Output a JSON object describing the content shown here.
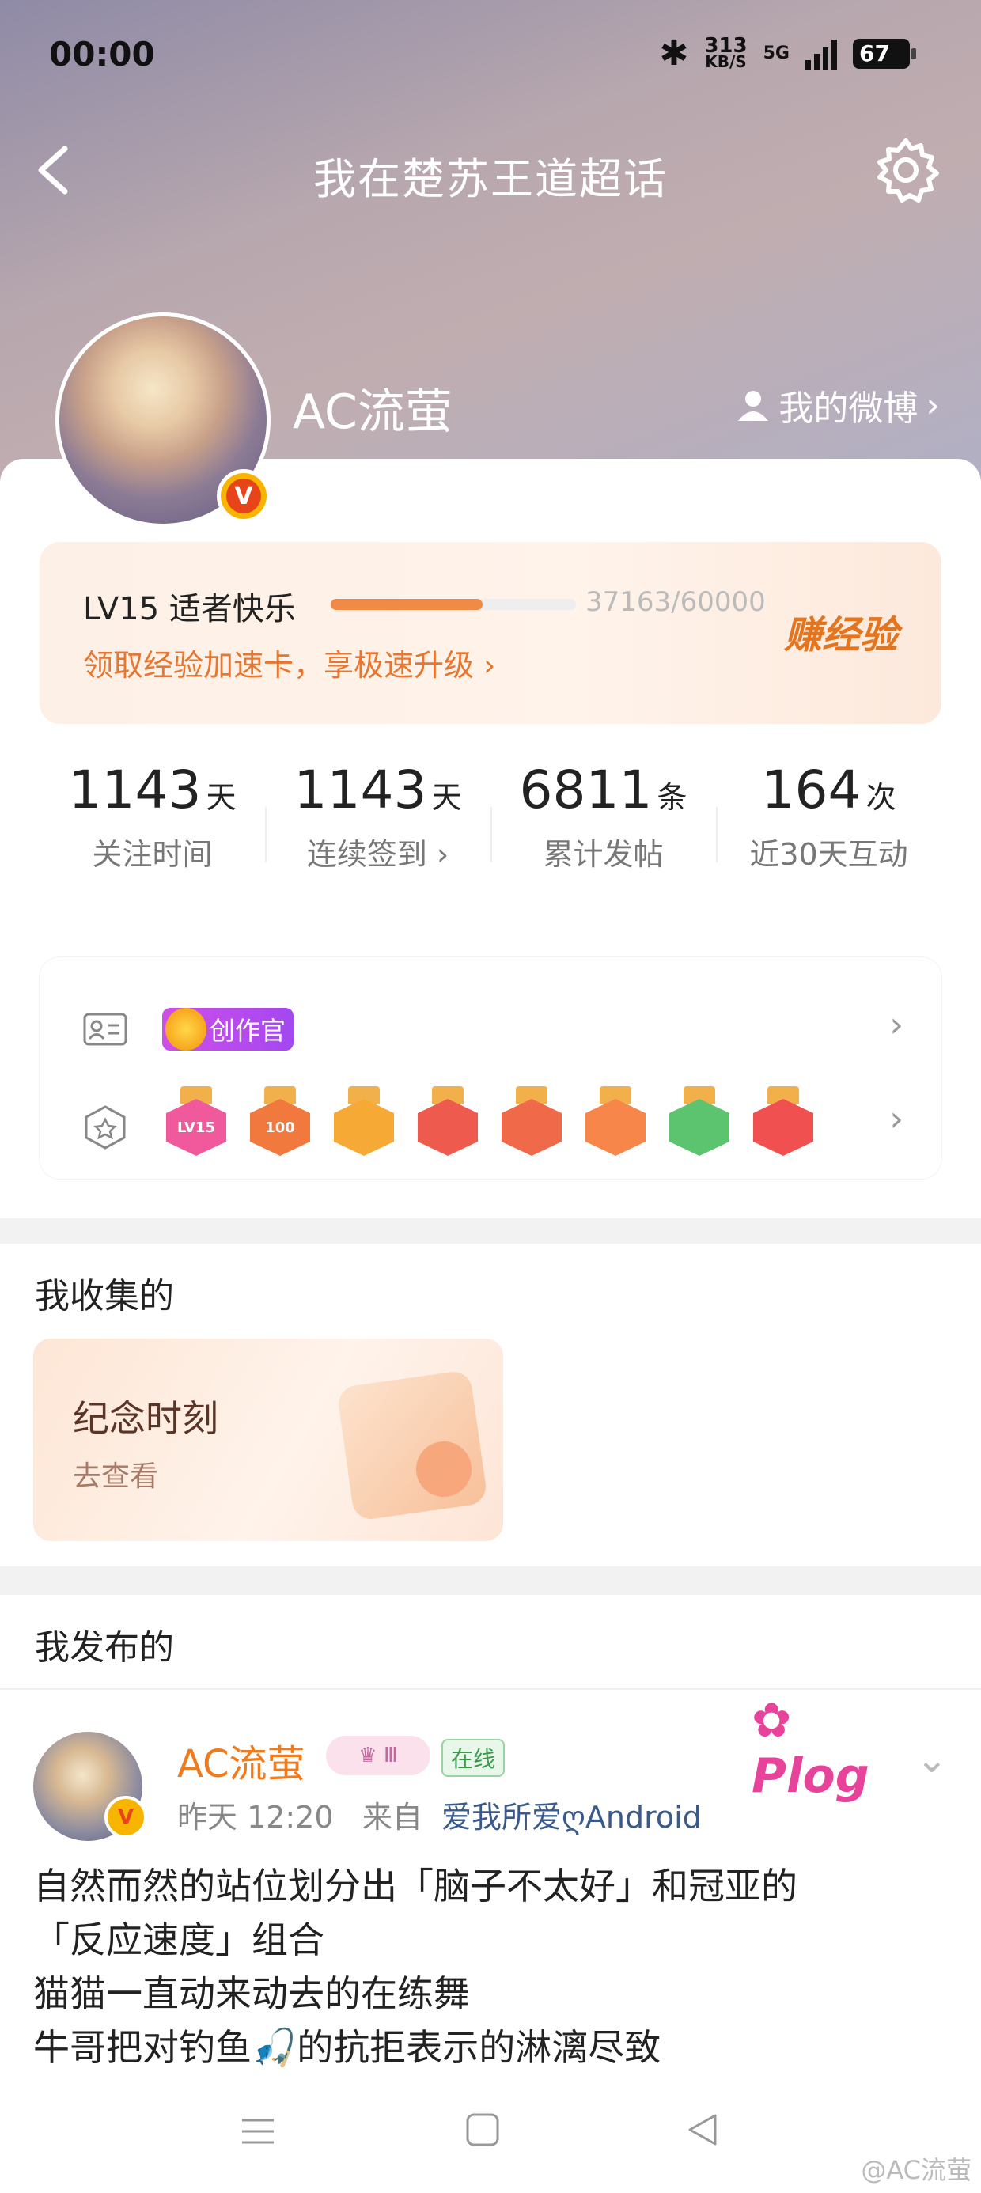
{
  "status_bar": {
    "time": "00:00",
    "net_speed": "313",
    "net_speed_unit": "KB/S",
    "network": "5G",
    "battery": "67"
  },
  "nav": {
    "title": "我在楚苏王道超话"
  },
  "profile": {
    "username": "AC流萤",
    "my_weibo": "我的微博"
  },
  "level": {
    "label": "LV15 适者快乐",
    "progress_text": "37163/60000",
    "progress_fraction": 0.619,
    "link": "领取经验加速卡，享极速升级",
    "earn": "赚经验"
  },
  "stats": [
    {
      "num": "1143",
      "unit": "天",
      "label": "关注时间"
    },
    {
      "num": "1143",
      "unit": "天",
      "label": "连续签到"
    },
    {
      "num": "6811",
      "unit": "条",
      "label": "累计发帖"
    },
    {
      "num": "164",
      "unit": "次",
      "label": "近30天互动"
    }
  ],
  "badges": {
    "creator_label": "创作官",
    "medals": [
      {
        "text": "LV15",
        "color": "#f05a9c"
      },
      {
        "text": "100",
        "color": "#f1793d"
      },
      {
        "text": "",
        "color": "#f7a935"
      },
      {
        "text": "",
        "color": "#ef5a4e"
      },
      {
        "text": "",
        "color": "#f06a4a"
      },
      {
        "text": "",
        "color": "#f6864a"
      },
      {
        "text": "",
        "color": "#5cc46f"
      },
      {
        "text": "",
        "color": "#f0504f"
      }
    ]
  },
  "collected": {
    "title": "我收集的",
    "card_title": "纪念时刻",
    "card_sub": "去查看"
  },
  "published": {
    "title": "我发布的"
  },
  "post": {
    "author": "AC流萤",
    "online": "在线",
    "time": "昨天 12:20",
    "from": "来自",
    "source": "爱我所爱ღAndroid",
    "lines": [
      "自然而然的站位划分出「脑子不太好」和冠亚的",
      "「反应速度」组合",
      "猫猫一直动来动去的在练舞",
      "牛哥把对钓鱼🎣的抗拒表示的淋漓尽致"
    ]
  },
  "watermark": "@AC流萤"
}
